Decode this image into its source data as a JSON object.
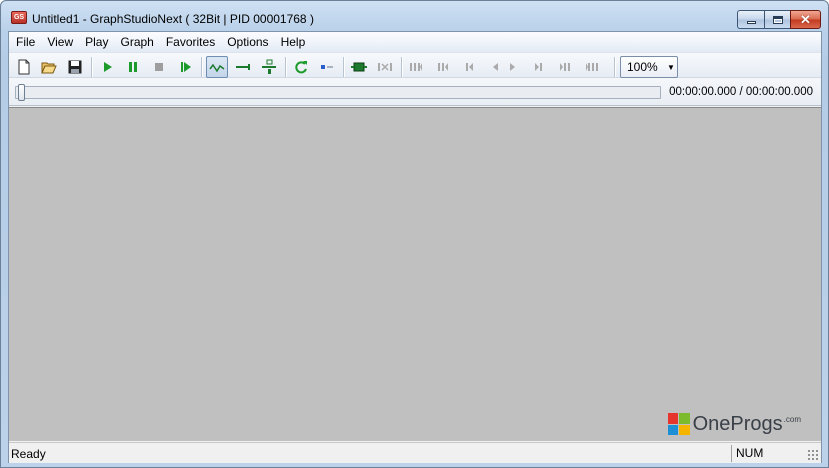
{
  "window": {
    "title": "Untitled1 - GraphStudioNext ( 32Bit | PID 00001768 )",
    "icon": "graphstudio-app-icon",
    "controls": [
      "minimize-icon",
      "maximize-icon",
      "close-icon"
    ]
  },
  "menu": {
    "items": [
      "File",
      "View",
      "Play",
      "Graph",
      "Favorites",
      "Options",
      "Help"
    ]
  },
  "toolbar": {
    "buttons": [
      {
        "icon": "new-file-icon"
      },
      {
        "icon": "open-folder-icon"
      },
      {
        "icon": "save-icon"
      },
      {
        "icon": "play-icon"
      },
      {
        "icon": "pause-icon"
      },
      {
        "icon": "stop-icon"
      },
      {
        "icon": "step-forward-icon"
      },
      {
        "icon": "connect-mode-icon",
        "pressed": true
      },
      {
        "icon": "direct-connect-icon"
      },
      {
        "icon": "intelligent-connect-icon"
      },
      {
        "icon": "refresh-icon"
      },
      {
        "icon": "seek-toggle-icon"
      },
      {
        "icon": "insert-filter-icon"
      },
      {
        "icon": "remove-filter-icon"
      },
      {
        "icon": "frame-back-far-icon"
      },
      {
        "icon": "frame-back-mid-icon"
      },
      {
        "icon": "frame-back-icon"
      },
      {
        "icon": "frame-step-back-icon"
      },
      {
        "icon": "frame-step-forward-icon"
      },
      {
        "icon": "frame-forward-icon"
      },
      {
        "icon": "frame-forward-mid-icon"
      },
      {
        "icon": "frame-forward-far-icon"
      }
    ],
    "zoom": "100%"
  },
  "seek": {
    "time": "00:00:00.000 / 00:00:00.000",
    "position": 0
  },
  "status": {
    "text": "Ready",
    "num": "NUM"
  },
  "logo": {
    "text": "OneProgs",
    "sup": ".com",
    "colors": [
      "#e5352d",
      "#7cbb2c",
      "#1e8fd5",
      "#f5b400"
    ]
  }
}
